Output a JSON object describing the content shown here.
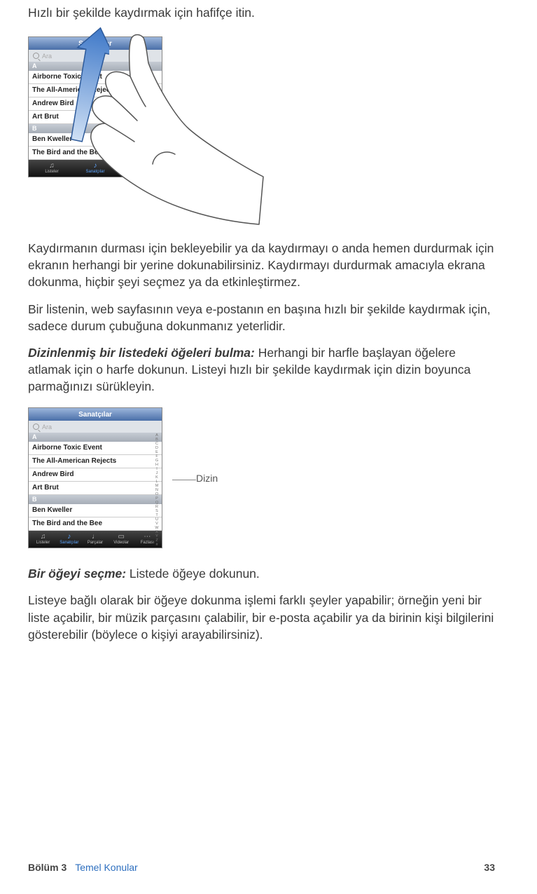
{
  "para1": "Hızlı bir şekilde kaydırmak için hafifçe itin.",
  "para2": "Kaydırmanın durması için bekleyebilir ya da kaydırmayı o anda hemen durdurmak için ekranın herhangi bir yerine dokunabilirsiniz. Kaydırmayı durdurmak amacıyla ekrana dokunma, hiçbir şeyi seçmez ya da etkinleştirmez.",
  "para3": "Bir listenin, web sayfasının veya e-postanın en başına hızlı bir şekilde kaydırmak için, sadece durum çubuğuna dokunmanız yeterlidir.",
  "heading1_bold": "Dizinlenmiş bir listedeki öğeleri bulma:  ",
  "heading1_rest": "Herhangi bir harfle başlayan öğelere atlamak için o harfe dokunun. Listeyi hızlı bir şekilde kaydırmak için dizin boyunca parmağınızı sürükleyin.",
  "callout": "Dizin",
  "heading2_bold": "Bir öğeyi seçme:  ",
  "heading2_rest": "Listede öğeye dokunun.",
  "para6": "Listeye bağlı olarak bir öğeye dokunma işlemi farklı şeyler yapabilir; örneğin yeni bir liste açabilir, bir müzik parçasını çalabilir, bir e-posta açabilir ya da birinin kişi bilgilerini gösterebilir (böylece o kişiyi arayabilirsiniz).",
  "ipod": {
    "title": "Sanatçılar",
    "search_ph": "Ara",
    "secA": "A",
    "secB": "B",
    "rows_a": [
      "Airborne Toxic Event",
      "The All-American Rejects",
      "Andrew Bird",
      "Art Brut"
    ],
    "rows_b": [
      "Ben Kweller",
      "The Bird and the Bee"
    ],
    "tabs": [
      "Listeler",
      "Sanatçılar",
      "Parçalar",
      "Videolar",
      "Fazlası"
    ],
    "tabs_short": [
      "Listeler",
      "Sanatçılar",
      "Parçalar"
    ]
  },
  "index_letters": [
    "A",
    "B",
    "C",
    "D",
    "E",
    "F",
    "G",
    "H",
    "I",
    "J",
    "K",
    "L",
    "M",
    "N",
    "O",
    "P",
    "Q",
    "R",
    "S",
    "T",
    "U",
    "V",
    "W",
    "X",
    "Y",
    "Z",
    "#"
  ],
  "footer": {
    "chapter_label": "Bölüm 3",
    "chapter_title": "Temel Konular",
    "page": "33"
  }
}
